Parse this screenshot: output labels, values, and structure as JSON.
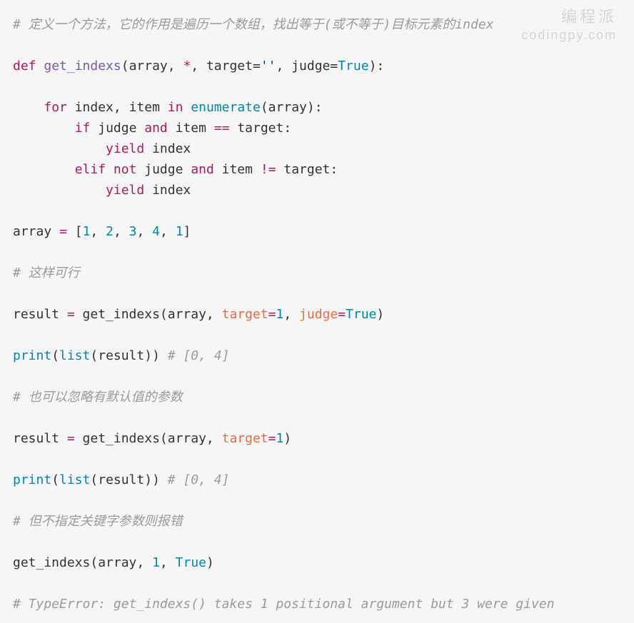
{
  "watermark": {
    "line1": "编程派",
    "line2": "codingpy.com"
  },
  "code": {
    "lines": [
      [
        {
          "c": "c",
          "t": "# 定义一个方法，它的作用是遍历一个数组，找出等于(或不等于)目标元素的index"
        }
      ],
      [],
      [
        {
          "c": "kw",
          "t": "def"
        },
        {
          "c": "tx",
          "t": " "
        },
        {
          "c": "fn",
          "t": "get_indexs"
        },
        {
          "c": "tx",
          "t": "(array, "
        },
        {
          "c": "kw",
          "t": "*"
        },
        {
          "c": "tx",
          "t": ", target="
        },
        {
          "c": "s",
          "t": "''"
        },
        {
          "c": "tx",
          "t": ", judge="
        },
        {
          "c": "bi",
          "t": "True"
        },
        {
          "c": "tx",
          "t": "):"
        }
      ],
      [],
      [
        {
          "c": "tx",
          "t": "    "
        },
        {
          "c": "kw",
          "t": "for"
        },
        {
          "c": "tx",
          "t": " index, item "
        },
        {
          "c": "kw",
          "t": "in"
        },
        {
          "c": "tx",
          "t": " "
        },
        {
          "c": "bi",
          "t": "enumerate"
        },
        {
          "c": "tx",
          "t": "(array):"
        }
      ],
      [
        {
          "c": "tx",
          "t": "        "
        },
        {
          "c": "kw",
          "t": "if"
        },
        {
          "c": "tx",
          "t": " judge "
        },
        {
          "c": "kw",
          "t": "and"
        },
        {
          "c": "tx",
          "t": " item "
        },
        {
          "c": "kw",
          "t": "=="
        },
        {
          "c": "tx",
          "t": " target:"
        }
      ],
      [
        {
          "c": "tx",
          "t": "            "
        },
        {
          "c": "kw",
          "t": "yield"
        },
        {
          "c": "tx",
          "t": " index"
        }
      ],
      [
        {
          "c": "tx",
          "t": "        "
        },
        {
          "c": "kw",
          "t": "elif"
        },
        {
          "c": "tx",
          "t": " "
        },
        {
          "c": "kw",
          "t": "not"
        },
        {
          "c": "tx",
          "t": " judge "
        },
        {
          "c": "kw",
          "t": "and"
        },
        {
          "c": "tx",
          "t": " item "
        },
        {
          "c": "kw",
          "t": "!="
        },
        {
          "c": "tx",
          "t": " target:"
        }
      ],
      [
        {
          "c": "tx",
          "t": "            "
        },
        {
          "c": "kw",
          "t": "yield"
        },
        {
          "c": "tx",
          "t": " index"
        }
      ],
      [],
      [
        {
          "c": "tx",
          "t": "array "
        },
        {
          "c": "kw",
          "t": "="
        },
        {
          "c": "tx",
          "t": " ["
        },
        {
          "c": "n",
          "t": "1"
        },
        {
          "c": "tx",
          "t": ", "
        },
        {
          "c": "n",
          "t": "2"
        },
        {
          "c": "tx",
          "t": ", "
        },
        {
          "c": "n",
          "t": "3"
        },
        {
          "c": "tx",
          "t": ", "
        },
        {
          "c": "n",
          "t": "4"
        },
        {
          "c": "tx",
          "t": ", "
        },
        {
          "c": "n",
          "t": "1"
        },
        {
          "c": "tx",
          "t": "]"
        }
      ],
      [],
      [
        {
          "c": "c",
          "t": "# 这样可行"
        }
      ],
      [],
      [
        {
          "c": "tx",
          "t": "result "
        },
        {
          "c": "kw",
          "t": "="
        },
        {
          "c": "tx",
          "t": " get_indexs(array, "
        },
        {
          "c": "pa",
          "t": "target"
        },
        {
          "c": "kw",
          "t": "="
        },
        {
          "c": "n",
          "t": "1"
        },
        {
          "c": "tx",
          "t": ", "
        },
        {
          "c": "pa",
          "t": "judge"
        },
        {
          "c": "kw",
          "t": "="
        },
        {
          "c": "bi",
          "t": "True"
        },
        {
          "c": "tx",
          "t": ")"
        }
      ],
      [],
      [
        {
          "c": "bi",
          "t": "print"
        },
        {
          "c": "tx",
          "t": "("
        },
        {
          "c": "bi",
          "t": "list"
        },
        {
          "c": "tx",
          "t": "(result)) "
        },
        {
          "c": "c",
          "t": "# [0, 4]"
        }
      ],
      [],
      [
        {
          "c": "c",
          "t": "# 也可以忽略有默认值的参数"
        }
      ],
      [],
      [
        {
          "c": "tx",
          "t": "result "
        },
        {
          "c": "kw",
          "t": "="
        },
        {
          "c": "tx",
          "t": " get_indexs(array, "
        },
        {
          "c": "pa",
          "t": "target"
        },
        {
          "c": "kw",
          "t": "="
        },
        {
          "c": "n",
          "t": "1"
        },
        {
          "c": "tx",
          "t": ")"
        }
      ],
      [],
      [
        {
          "c": "bi",
          "t": "print"
        },
        {
          "c": "tx",
          "t": "("
        },
        {
          "c": "bi",
          "t": "list"
        },
        {
          "c": "tx",
          "t": "(result)) "
        },
        {
          "c": "c",
          "t": "# [0, 4]"
        }
      ],
      [],
      [
        {
          "c": "c",
          "t": "# 但不指定关键字参数则报错"
        }
      ],
      [],
      [
        {
          "c": "tx",
          "t": "get_indexs(array, "
        },
        {
          "c": "n",
          "t": "1"
        },
        {
          "c": "tx",
          "t": ", "
        },
        {
          "c": "bi",
          "t": "True"
        },
        {
          "c": "tx",
          "t": ")"
        }
      ],
      [],
      [
        {
          "c": "c",
          "t": "# TypeError: get_indexs() takes 1 positional argument but 3 were given"
        }
      ]
    ]
  }
}
